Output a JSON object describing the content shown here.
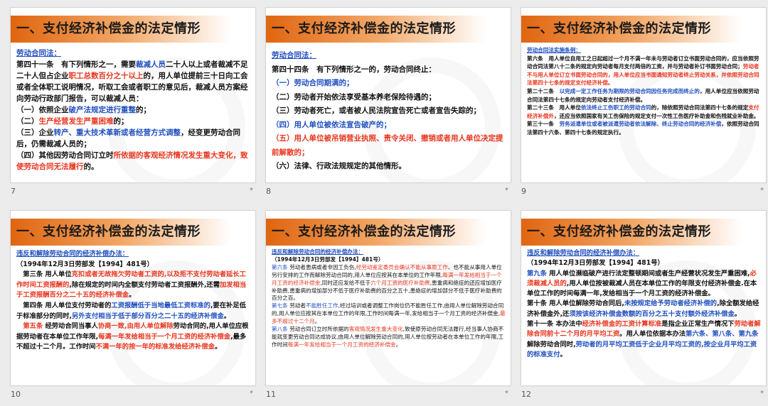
{
  "slides": [
    {
      "number": "7",
      "title": "一、支付经济补偿金的法定情形",
      "subtitle": "劳动合同法：",
      "paras": [
        [
          {
            "t": "第四十一条　有下列情形之一，需要"
          },
          {
            "t": "裁减人员",
            "c": "blue"
          },
          {
            "t": "二十人以上或者裁减不足二十人但占企业"
          },
          {
            "t": "职工总数百分之十以上",
            "c": "red"
          },
          {
            "t": "的，用人单位提前三十日向工会或者全体职工说明情况，听取工会或者职工的意见后，裁减人员方案经向劳动行政部门报告，可以裁减人员："
          }
        ],
        [
          {
            "t": "（一）依照企业"
          },
          {
            "t": "破产法规定进行重整",
            "c": "blue"
          },
          {
            "t": "的；"
          }
        ],
        [
          {
            "t": "（二）"
          },
          {
            "t": "生产经营发生严重困难",
            "c": "red"
          },
          {
            "t": "的；"
          }
        ],
        [
          {
            "t": "（三）企业"
          },
          {
            "t": "转产、重大技术革新或者经营方式调整",
            "c": "blue"
          },
          {
            "t": "，经变更劳动合同后，仍需裁减人员的；"
          }
        ],
        [
          {
            "t": "（四）其他因劳动合同订立时"
          },
          {
            "t": "所依据的客观经济情况发生重大变化，致使劳动合同无法履行",
            "c": "red"
          },
          {
            "t": "的。"
          }
        ]
      ]
    },
    {
      "number": "8",
      "title": "一、支付经济补偿金的法定情形",
      "subtitle": "劳动合同法：",
      "paras": [
        [
          {
            "t": "第四十四条　有下列情形之一的，劳动合同终止："
          }
        ],
        [
          {
            "t": "（一）劳动合同期满的；",
            "c": "blue"
          }
        ],
        [
          {
            "t": "（二）劳动者开始依法享受基本养老保险待遇的；"
          }
        ],
        [
          {
            "t": "（三）劳动者死亡，或者被人民法院宣告死亡或者宣告失踪的；"
          }
        ],
        [
          {
            "t": "（四）用人单位被依法宣告破产的；",
            "c": "blue"
          }
        ],
        [
          {
            "t": "（五）用人单位被吊销营业执照、责令关闭、撤销或者用人单位决定提前解散的；",
            "c": "red"
          }
        ],
        [
          {
            "t": "（六）法律、行政法规规定的其他情形。"
          }
        ]
      ]
    },
    {
      "number": "9",
      "title": "一、支付经济补偿金的法定情形",
      "subtitle": "劳动合同法实施条例：",
      "paras": [
        [
          {
            "t": "第六条　用人单位自用工之日起超过一个月不满一年未与劳动者订立书面劳动合同的，应当依照劳动合同法第八十二条的规定向劳动者每月支付两倍的工资，并与劳动者补订书面劳动合同；"
          },
          {
            "t": "劳动者不与用人单位订立书面劳动合同的，用人单位应当书面通知劳动者终止劳动关系，并依照劳动合同法第四十七条的规定支付经济补偿。",
            "c": "red"
          }
        ],
        [
          {
            "t": "第二十二条　"
          },
          {
            "t": "以完成一定工作任务为期限的劳动合同因任务完成而终止的",
            "c": "blue"
          },
          {
            "t": "，用人单位应当依照劳动合同法第四十七条的规定向劳动者支付经济补偿。"
          }
        ],
        [
          {
            "t": "第二十三条　用人单位"
          },
          {
            "t": "依法终止工伤职工的劳动合同",
            "c": "blue"
          },
          {
            "t": "的，除依照劳动合同法第四十七条的规定"
          },
          {
            "t": "支付经济补偿外",
            "c": "red"
          },
          {
            "t": "，还应当依照国家有关工伤保险的规定支付一次性工伤医疗补助金和伤残就业补助金。"
          }
        ],
        [
          {
            "t": "第三十一条　"
          },
          {
            "t": "劳务派遣单位或者被派遣劳动者依法解除、终止劳动合同的经济补偿",
            "c": "blue"
          },
          {
            "t": "，依照劳动合同法第四十六条、第四十七条的规定执行。"
          }
        ]
      ]
    },
    {
      "number": "10",
      "title": "一、支付经济补偿金的法定情形",
      "subtitle": "违反和解除劳动合同的经济补偿办法：",
      "paras": [
        [
          {
            "t": "（1994年12月3日劳部发【1994】481号）"
          }
        ],
        [
          {
            "t": "　第三条 用人单位"
          },
          {
            "t": "克扣或者无故拖欠劳动者工资的,以及拒不支付劳动者延长工作时间工资报酬的",
            "c": "red"
          },
          {
            "t": ",除在规定的时间内全额支付劳动者工资报酬外,还需"
          },
          {
            "t": "加发相当于工资报酬百分之二十五的经济补偿金",
            "c": "red"
          },
          {
            "t": "。"
          }
        ],
        [
          {
            "t": "　第四条 用人单位支付劳动者的"
          },
          {
            "t": "工资报酬低于当地最低工资标准的",
            "c": "blue"
          },
          {
            "t": ",要在补足低于标准部分的同时,"
          },
          {
            "t": "另外支付相当于低于部分百分之二十五的经济补偿金",
            "c": "blue"
          },
          {
            "t": "。"
          }
        ],
        [
          {
            "t": "　"
          },
          {
            "t": "第五条",
            "c": "red"
          },
          {
            "t": " 经劳动合同当事人"
          },
          {
            "t": "协商一致,由用人单位解除",
            "c": "red"
          },
          {
            "t": "劳动合同的,用人单位应根据劳动者在本单位工作年限,"
          },
          {
            "t": "每满一年发给相当于一个月工资的经济补偿金",
            "c": "red"
          },
          {
            "t": ",最多不超过十二个月。工作时间"
          },
          {
            "t": "不满一年的按一年的标准发给经济补偿金",
            "c": "red"
          },
          {
            "t": "。"
          }
        ]
      ]
    },
    {
      "number": "11",
      "title": "一、支付经济补偿金的法定情形",
      "subtitle": "违反和解除劳动合同的经济补偿办法：",
      "paras": [
        [
          {
            "t": "（1994年12月3日劳部发【1994】481号）",
            "b": true
          }
        ],
        [
          {
            "t": "第六条",
            "c": "blue"
          },
          {
            "t": " 劳动者患病或者非因工负伤,"
          },
          {
            "t": "经劳动鉴定委员会确认不能从事原工作",
            "c": "red"
          },
          {
            "t": "、也不能从事用人单位另行安排的工作而解除劳动合同的,用人单位应按其在本单位的工作年限,"
          },
          {
            "t": "每满一年发给相当于一个月工资的经济补偿金",
            "c": "red"
          },
          {
            "t": ",同时还应发给不低于"
          },
          {
            "t": "六个月工资的医疗补助费",
            "c": "red"
          },
          {
            "t": ",患重病和绝症的还应增加医疗补助费,患重病的增加部分不低于医疗补助费的百分之五十,患绝症的增加部分不低于医疗补助费的百分之百。"
          }
        ],
        [
          {
            "t": "第七条",
            "c": "blue"
          },
          {
            "t": " 劳动者"
          },
          {
            "t": "不能胜任工作",
            "c": "blue"
          },
          {
            "t": ",经过培训或者调整工作岗位仍不能胜任工作,由用人单位解除劳动合同的,用人单位应按其在本单位工作的年限,工作时间每满一年,发给相当于一个月工资的经济补偿金,"
          },
          {
            "t": "最多不超过十二个月",
            "c": "red"
          },
          {
            "t": "。"
          }
        ],
        [
          {
            "t": "第八条",
            "c": "blue"
          },
          {
            "t": " 劳动合同订立时所依据的"
          },
          {
            "t": "客观情况发生重大变化",
            "c": "red"
          },
          {
            "t": ",致使原劳动合同无法履行,经当事人协商不能就变更劳动合同达成协议,由用人单位解除劳动合同的,用人单位按劳动者在本单位工作的年限,工作时间"
          },
          {
            "t": "每满一年发给相当于一个月工资的经济补偿金",
            "c": "red"
          },
          {
            "t": "。"
          }
        ]
      ]
    },
    {
      "number": "12",
      "title": "一、支付经济补偿金的法定情形",
      "subtitle": "违反和解除劳动合同的经济补偿办法：",
      "paras": [
        [
          {
            "t": "（1994年12月3日劳部发【1994】481号）"
          }
        ],
        [
          {
            "t": "第九条",
            "c": "blue"
          },
          {
            "t": " 用人单位濒临破产进行法定整顿期间或者生产经营状况发生严重困难,"
          },
          {
            "t": "必须裁减人员的",
            "c": "red"
          },
          {
            "t": ",用人单位按被裁减人员在本单位工作的年限支付经济补偿金.在本单位工作的时间每满一年,发给相当于一个月工资的经济补偿金。"
          }
        ],
        [
          {
            "t": "第十条 用人单位解除劳动合同后,"
          },
          {
            "t": "未按规定给予劳动者经济补偿的",
            "c": "blue"
          },
          {
            "t": ",除全额发给经济补偿金外,还"
          },
          {
            "t": "须按该经济补偿金数额的百分之五十支付额外经济补偿金",
            "c": "blue"
          },
          {
            "t": "。"
          }
        ],
        [
          {
            "t": "第十一条 本办法中"
          },
          {
            "t": "经济补偿金的工资计算标准",
            "c": "red"
          },
          {
            "t": "是指企业正常生产情况下"
          },
          {
            "t": "劳动者解除合同前十二个月的月平均工资",
            "c": "red"
          },
          {
            "t": "。用人单位依据本办法"
          },
          {
            "t": "第六条、第八条、第九条",
            "c": "blue"
          },
          {
            "t": "解除劳动合同时,"
          },
          {
            "t": "劳动者的月平均工资低于企业月平均工资的,按企业月平均工资的标准支付",
            "c": "blue"
          },
          {
            "t": "。"
          }
        ]
      ]
    }
  ],
  "colors": {
    "accent": "#e0650f",
    "red": "#e8361e",
    "blue": "#1f4fbf",
    "selected": "#e6a23c"
  },
  "icons": {
    "star": "star-icon"
  },
  "star_glyph": "*"
}
